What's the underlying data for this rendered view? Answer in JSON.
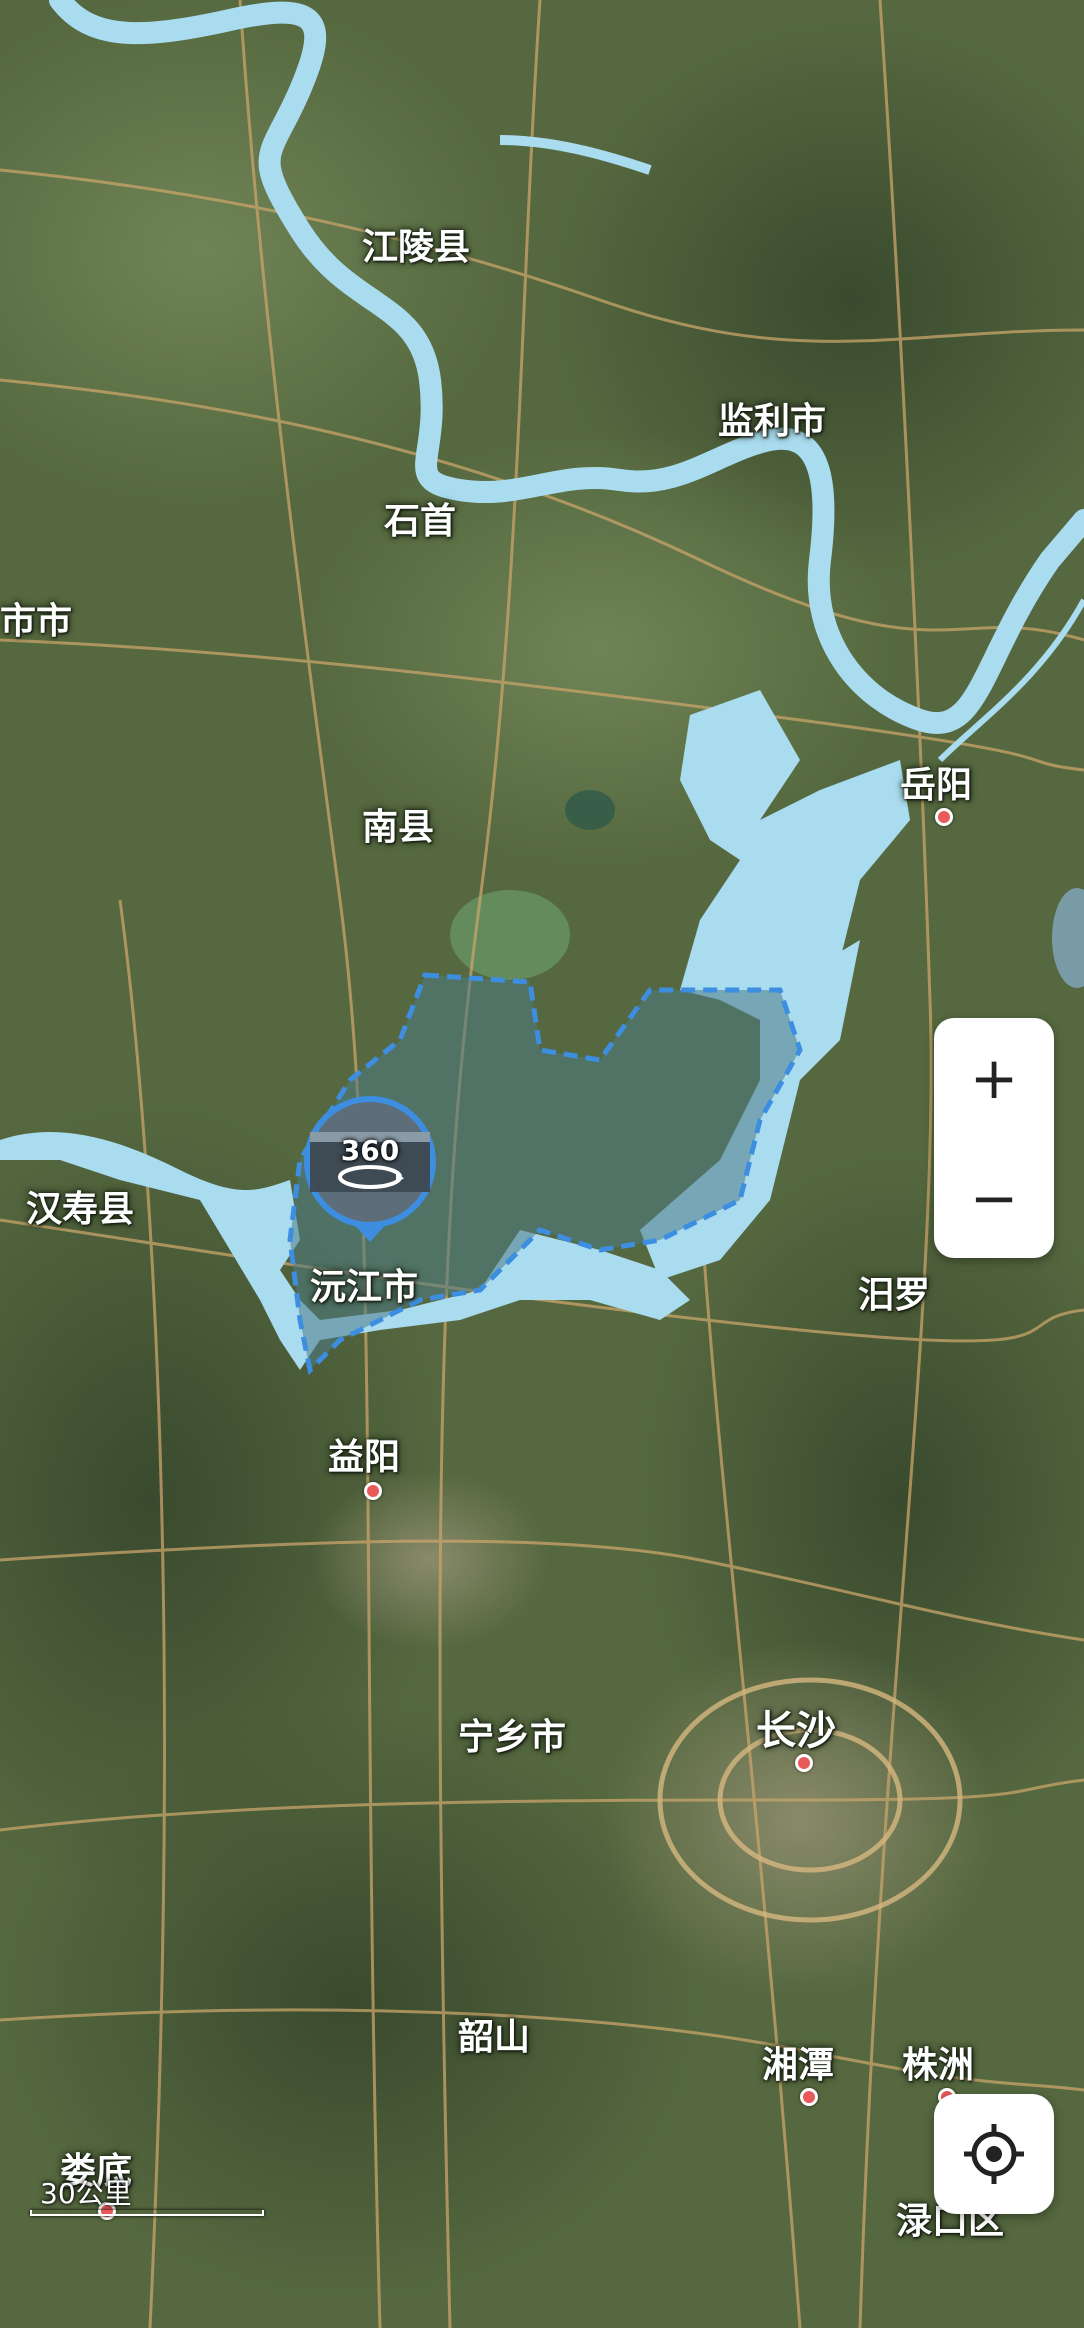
{
  "map": {
    "type": "satellite",
    "labels": [
      {
        "name": "江陵县"
      },
      {
        "name": "监利市"
      },
      {
        "name": "石首"
      },
      {
        "name": "市市"
      },
      {
        "name": "岳阳"
      },
      {
        "name": "南县"
      },
      {
        "name": "汉寿县"
      },
      {
        "name": "沅江市"
      },
      {
        "name": "汨罗"
      },
      {
        "name": "益阳"
      },
      {
        "name": "宁乡市"
      },
      {
        "name": "长沙"
      },
      {
        "name": "韶山"
      },
      {
        "name": "湘潭"
      },
      {
        "name": "株洲"
      },
      {
        "name": "娄底"
      },
      {
        "name": "渌口区"
      }
    ],
    "colors": {
      "water": "#a9dcef",
      "highlight_border": "#3d8ee0",
      "highlight_fill": "#4e7c86",
      "road": "#c9a56a",
      "city_dot": "#e85a5a"
    }
  },
  "pano_marker": {
    "text": "360",
    "icon": "panorama-360-icon"
  },
  "controls": {
    "zoom_in": "+",
    "zoom_out": "−",
    "locate_icon": "locate-crosshair-icon"
  },
  "scale": {
    "text": "30公里"
  }
}
